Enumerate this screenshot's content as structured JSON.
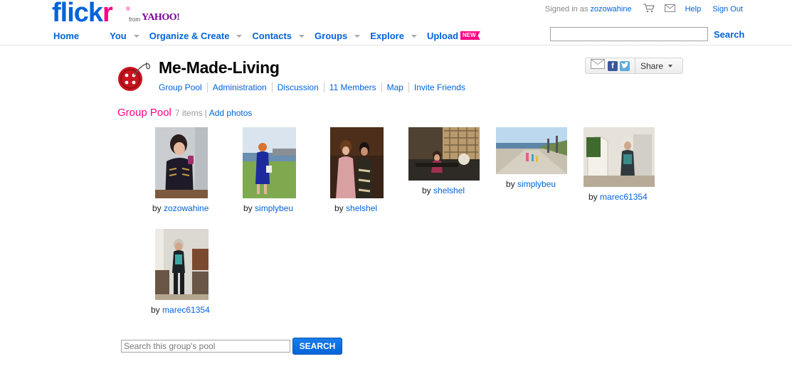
{
  "logo": {
    "wordmark_left": "flick",
    "wordmark_right": "r",
    "registered": "®",
    "from_text": "from",
    "yahoo_text": "YAHOO!"
  },
  "main_nav": [
    {
      "label": "Home",
      "has_menu": false
    },
    {
      "label": "You",
      "has_menu": true
    },
    {
      "label": "Organize & Create",
      "has_menu": true
    },
    {
      "label": "Contacts",
      "has_menu": true
    },
    {
      "label": "Groups",
      "has_menu": true
    },
    {
      "label": "Explore",
      "has_menu": true
    },
    {
      "label": "Upload",
      "has_menu": false,
      "badge": "NEW"
    }
  ],
  "account": {
    "signed_in_as": "Signed in as",
    "username": "zozowahine",
    "help": "Help",
    "sign_out": "Sign Out",
    "icons": [
      "cart-icon",
      "mail-icon"
    ]
  },
  "top_search": {
    "value": "",
    "button": "Search"
  },
  "group": {
    "title": "Me-Made-Living",
    "nav": [
      "Group Pool",
      "Administration",
      "Discussion",
      "11 Members",
      "Map",
      "Invite Friends"
    ]
  },
  "share": {
    "label": "Share",
    "icons": [
      "email-icon",
      "facebook-icon",
      "twitter-icon"
    ]
  },
  "pool": {
    "title": "Group Pool",
    "count": "7 items",
    "separator": "|",
    "add_photos": "Add photos",
    "photos": [
      {
        "by": "by",
        "user": "zozowahine"
      },
      {
        "by": "by",
        "user": "simplybeu"
      },
      {
        "by": "by",
        "user": "shelshel"
      },
      {
        "by": "by",
        "user": "shelshel"
      },
      {
        "by": "by",
        "user": "simplybeu"
      },
      {
        "by": "by",
        "user": "marec61354"
      },
      {
        "by": "by",
        "user": "marec61354"
      }
    ]
  },
  "pool_search": {
    "placeholder": "Search this group's pool",
    "button": "SEARCH"
  },
  "colors": {
    "link": "#0063dc",
    "pink": "#ff0084",
    "yahoo_purple": "#7b0099"
  }
}
